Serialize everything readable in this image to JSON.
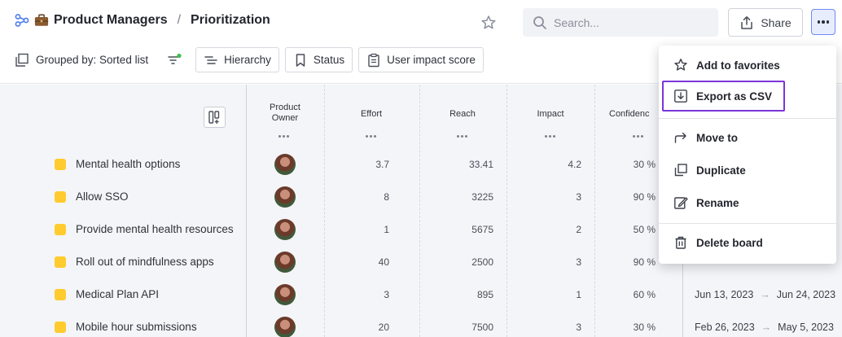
{
  "breadcrumb": {
    "workspace_icon": "briefcase-emoji",
    "workspace": "Product Managers",
    "separator": "/",
    "board": "Prioritization"
  },
  "header": {
    "search_placeholder": "Search...",
    "share_label": "Share"
  },
  "toolbar": {
    "grouped_label": "Grouped by: Sorted list",
    "pills": [
      "Hierarchy",
      "Status",
      "User impact score"
    ]
  },
  "columns": {
    "owner": "Product\nOwner",
    "effort": "Effort",
    "reach": "Reach",
    "impact": "Impact",
    "confidence": "Confidenc"
  },
  "rows": [
    {
      "name": "Mental health options",
      "effort": "3.7",
      "reach": "33.41",
      "impact": "4.2",
      "confidence": "30 %",
      "start": "",
      "end": ""
    },
    {
      "name": "Allow SSO",
      "effort": "8",
      "reach": "3225",
      "impact": "3",
      "confidence": "90 %",
      "start": "",
      "end": ""
    },
    {
      "name": "Provide mental health resources",
      "effort": "1",
      "reach": "5675",
      "impact": "2",
      "confidence": "50 %",
      "start": "",
      "end": ""
    },
    {
      "name": "Roll out of mindfulness apps",
      "effort": "40",
      "reach": "2500",
      "impact": "3",
      "confidence": "90 %",
      "start": "",
      "end": ""
    },
    {
      "name": "Medical Plan API",
      "effort": "3",
      "reach": "895",
      "impact": "1",
      "confidence": "60 %",
      "start": "Jun 13, 2023",
      "end": "Jun 24, 2023"
    },
    {
      "name": "Mobile hour submissions",
      "effort": "20",
      "reach": "7500",
      "impact": "3",
      "confidence": "30 %",
      "start": "Feb 26, 2023",
      "end": "May 5, 2023"
    }
  ],
  "menu": {
    "items": [
      "Add to favorites",
      "Export as CSV",
      "Move to",
      "Duplicate",
      "Rename",
      "Delete board"
    ],
    "highlighted": "Export as CSV"
  },
  "colors": {
    "chip": "#ffcb2f",
    "highlight_border": "#7b35d9",
    "more_button_bg": "#e8edfd"
  }
}
